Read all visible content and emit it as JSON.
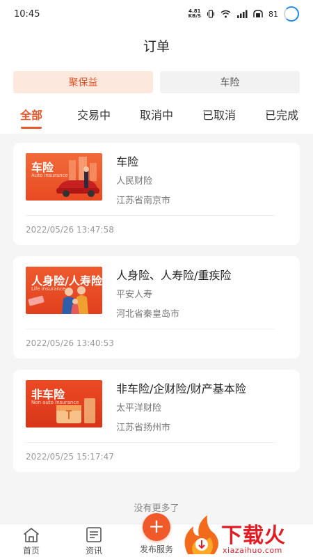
{
  "status_bar": {
    "time": "10:45",
    "net_speed_top": "4.81",
    "net_speed_bottom": "KB/S",
    "battery": "81",
    "icons": [
      "vibrate-icon",
      "wifi-icon",
      "signal-icon",
      "hd-icon",
      "battery-icon"
    ]
  },
  "header": {
    "title": "订单"
  },
  "segments": {
    "first": "聚保益",
    "second": "车险"
  },
  "tabs": [
    "全部",
    "交易中",
    "取消中",
    "已取消",
    "已完成"
  ],
  "orders": [
    {
      "thumb_label": "车险",
      "thumb_sub": "Auto insurance",
      "title": "车险",
      "company": "人民财险",
      "region": "江苏省南京市",
      "date": "2022/05/26 13:47:58"
    },
    {
      "thumb_label": "人身险/人寿险",
      "thumb_sub": "Life insurance",
      "title": "人身险、人寿险/重疾险",
      "company": "平安人寿",
      "region": "河北省秦皇岛市",
      "date": "2022/05/26 13:40:53"
    },
    {
      "thumb_label": "非车险",
      "thumb_sub": "Non auto Insurance",
      "title": "非车险/企财险/财产基本险",
      "company": "太平洋财险",
      "region": "江苏省扬州市",
      "date": "2022/05/25 15:17:47"
    }
  ],
  "footer_note": "没有更多了",
  "bottom_nav": {
    "home": "首页",
    "news": "资讯",
    "publish": "发布服务"
  },
  "watermark": {
    "text": "下载火",
    "url": "xiazaihuo.com"
  },
  "colors": {
    "accent": "#e8562a",
    "publish": "#f05a2a",
    "watermark": "#e31b23"
  }
}
